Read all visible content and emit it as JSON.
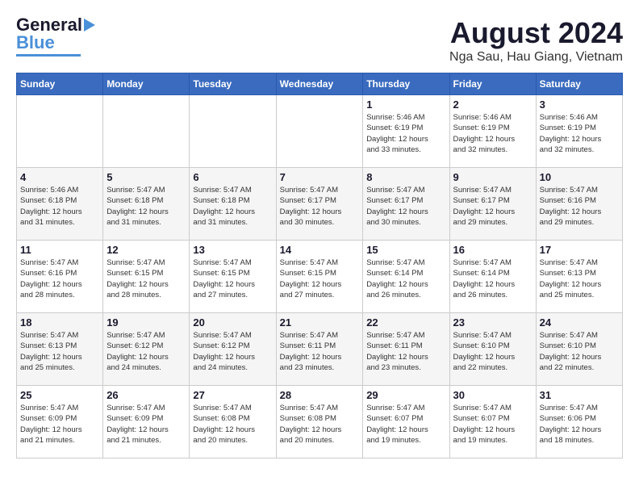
{
  "logo": {
    "line1": "General",
    "line2": "Blue"
  },
  "title": "August 2024",
  "subtitle": "Nga Sau, Hau Giang, Vietnam",
  "days_of_week": [
    "Sunday",
    "Monday",
    "Tuesday",
    "Wednesday",
    "Thursday",
    "Friday",
    "Saturday"
  ],
  "weeks": [
    [
      {
        "day": "",
        "info": ""
      },
      {
        "day": "",
        "info": ""
      },
      {
        "day": "",
        "info": ""
      },
      {
        "day": "",
        "info": ""
      },
      {
        "day": "1",
        "info": "Sunrise: 5:46 AM\nSunset: 6:19 PM\nDaylight: 12 hours\nand 33 minutes."
      },
      {
        "day": "2",
        "info": "Sunrise: 5:46 AM\nSunset: 6:19 PM\nDaylight: 12 hours\nand 32 minutes."
      },
      {
        "day": "3",
        "info": "Sunrise: 5:46 AM\nSunset: 6:19 PM\nDaylight: 12 hours\nand 32 minutes."
      }
    ],
    [
      {
        "day": "4",
        "info": "Sunrise: 5:46 AM\nSunset: 6:18 PM\nDaylight: 12 hours\nand 31 minutes."
      },
      {
        "day": "5",
        "info": "Sunrise: 5:47 AM\nSunset: 6:18 PM\nDaylight: 12 hours\nand 31 minutes."
      },
      {
        "day": "6",
        "info": "Sunrise: 5:47 AM\nSunset: 6:18 PM\nDaylight: 12 hours\nand 31 minutes."
      },
      {
        "day": "7",
        "info": "Sunrise: 5:47 AM\nSunset: 6:17 PM\nDaylight: 12 hours\nand 30 minutes."
      },
      {
        "day": "8",
        "info": "Sunrise: 5:47 AM\nSunset: 6:17 PM\nDaylight: 12 hours\nand 30 minutes."
      },
      {
        "day": "9",
        "info": "Sunrise: 5:47 AM\nSunset: 6:17 PM\nDaylight: 12 hours\nand 29 minutes."
      },
      {
        "day": "10",
        "info": "Sunrise: 5:47 AM\nSunset: 6:16 PM\nDaylight: 12 hours\nand 29 minutes."
      }
    ],
    [
      {
        "day": "11",
        "info": "Sunrise: 5:47 AM\nSunset: 6:16 PM\nDaylight: 12 hours\nand 28 minutes."
      },
      {
        "day": "12",
        "info": "Sunrise: 5:47 AM\nSunset: 6:15 PM\nDaylight: 12 hours\nand 28 minutes."
      },
      {
        "day": "13",
        "info": "Sunrise: 5:47 AM\nSunset: 6:15 PM\nDaylight: 12 hours\nand 27 minutes."
      },
      {
        "day": "14",
        "info": "Sunrise: 5:47 AM\nSunset: 6:15 PM\nDaylight: 12 hours\nand 27 minutes."
      },
      {
        "day": "15",
        "info": "Sunrise: 5:47 AM\nSunset: 6:14 PM\nDaylight: 12 hours\nand 26 minutes."
      },
      {
        "day": "16",
        "info": "Sunrise: 5:47 AM\nSunset: 6:14 PM\nDaylight: 12 hours\nand 26 minutes."
      },
      {
        "day": "17",
        "info": "Sunrise: 5:47 AM\nSunset: 6:13 PM\nDaylight: 12 hours\nand 25 minutes."
      }
    ],
    [
      {
        "day": "18",
        "info": "Sunrise: 5:47 AM\nSunset: 6:13 PM\nDaylight: 12 hours\nand 25 minutes."
      },
      {
        "day": "19",
        "info": "Sunrise: 5:47 AM\nSunset: 6:12 PM\nDaylight: 12 hours\nand 24 minutes."
      },
      {
        "day": "20",
        "info": "Sunrise: 5:47 AM\nSunset: 6:12 PM\nDaylight: 12 hours\nand 24 minutes."
      },
      {
        "day": "21",
        "info": "Sunrise: 5:47 AM\nSunset: 6:11 PM\nDaylight: 12 hours\nand 23 minutes."
      },
      {
        "day": "22",
        "info": "Sunrise: 5:47 AM\nSunset: 6:11 PM\nDaylight: 12 hours\nand 23 minutes."
      },
      {
        "day": "23",
        "info": "Sunrise: 5:47 AM\nSunset: 6:10 PM\nDaylight: 12 hours\nand 22 minutes."
      },
      {
        "day": "24",
        "info": "Sunrise: 5:47 AM\nSunset: 6:10 PM\nDaylight: 12 hours\nand 22 minutes."
      }
    ],
    [
      {
        "day": "25",
        "info": "Sunrise: 5:47 AM\nSunset: 6:09 PM\nDaylight: 12 hours\nand 21 minutes."
      },
      {
        "day": "26",
        "info": "Sunrise: 5:47 AM\nSunset: 6:09 PM\nDaylight: 12 hours\nand 21 minutes."
      },
      {
        "day": "27",
        "info": "Sunrise: 5:47 AM\nSunset: 6:08 PM\nDaylight: 12 hours\nand 20 minutes."
      },
      {
        "day": "28",
        "info": "Sunrise: 5:47 AM\nSunset: 6:08 PM\nDaylight: 12 hours\nand 20 minutes."
      },
      {
        "day": "29",
        "info": "Sunrise: 5:47 AM\nSunset: 6:07 PM\nDaylight: 12 hours\nand 19 minutes."
      },
      {
        "day": "30",
        "info": "Sunrise: 5:47 AM\nSunset: 6:07 PM\nDaylight: 12 hours\nand 19 minutes."
      },
      {
        "day": "31",
        "info": "Sunrise: 5:47 AM\nSunset: 6:06 PM\nDaylight: 12 hours\nand 18 minutes."
      }
    ]
  ]
}
